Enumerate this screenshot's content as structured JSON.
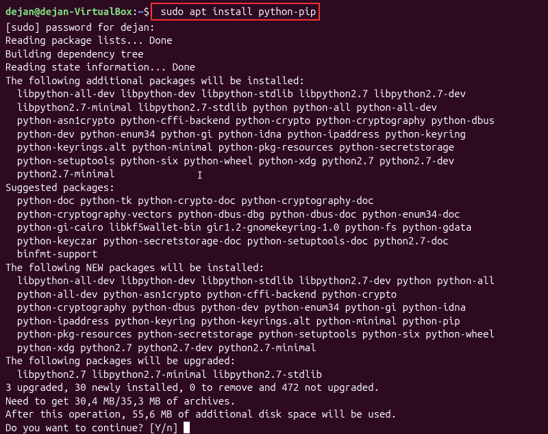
{
  "prompt": {
    "user_host": "dejan@dejan-VirtualBox",
    "colon": ":",
    "path": "~",
    "dollar": "$",
    "command": " sudo apt install python-pip"
  },
  "lines": {
    "sudo_prompt": "[sudo] password for dejan:",
    "reading_lists": "Reading package lists... Done",
    "building_tree": "Building dependency tree",
    "reading_state": "Reading state information... Done",
    "additional_header": "The following additional packages will be installed:",
    "additional_1": "libpython-all-dev libpython-dev libpython-stdlib libpython2.7 libpython2.7-dev",
    "additional_2": "libpython2.7-minimal libpython2.7-stdlib python python-all python-all-dev",
    "additional_3": "python-asn1crypto python-cffi-backend python-crypto python-cryptography python-dbus",
    "additional_4": "python-dev python-enum34 python-gi python-idna python-ipaddress python-keyring",
    "additional_5": "python-keyrings.alt python-minimal python-pkg-resources python-secretstorage",
    "additional_6": "python-setuptools python-six python-wheel python-xdg python2.7 python2.7-dev",
    "additional_7": "python2.7-minimal",
    "suggested_header": "Suggested packages:",
    "suggested_1": "python-doc python-tk python-crypto-doc python-cryptography-doc",
    "suggested_2": "python-cryptography-vectors python-dbus-dbg python-dbus-doc python-enum34-doc",
    "suggested_3": "python-gi-cairo libkf5wallet-bin gir1.2-gnomekeyring-1.0 python-fs python-gdata",
    "suggested_4": "python-keyczar python-secretstorage-doc python-setuptools-doc python2.7-doc",
    "suggested_5": "binfmt-support",
    "new_header": "The following NEW packages will be installed:",
    "new_1": "libpython-all-dev libpython-dev libpython-stdlib libpython2.7-dev python python-all",
    "new_2": "python-all-dev python-asn1crypto python-cffi-backend python-crypto",
    "new_3": "python-cryptography python-dbus python-dev python-enum34 python-gi python-idna",
    "new_4": "python-ipaddress python-keyring python-keyrings.alt python-minimal python-pip",
    "new_5": "python-pkg-resources python-secretstorage python-setuptools python-six python-wheel",
    "new_6": "python-xdg python2.7 python2.7-dev python2.7-minimal",
    "upgraded_header": "The following packages will be upgraded:",
    "upgraded_1": "libpython2.7 libpython2.7-minimal libpython2.7-stdlib",
    "summary": "3 upgraded, 30 newly installed, 0 to remove and 472 not upgraded.",
    "need_get": "Need to get 30,4 MB/35,3 MB of archives.",
    "after_op": "After this operation, 55,6 MB of additional disk space will be used.",
    "continue_prompt": "Do you want to continue? [Y/n] "
  }
}
